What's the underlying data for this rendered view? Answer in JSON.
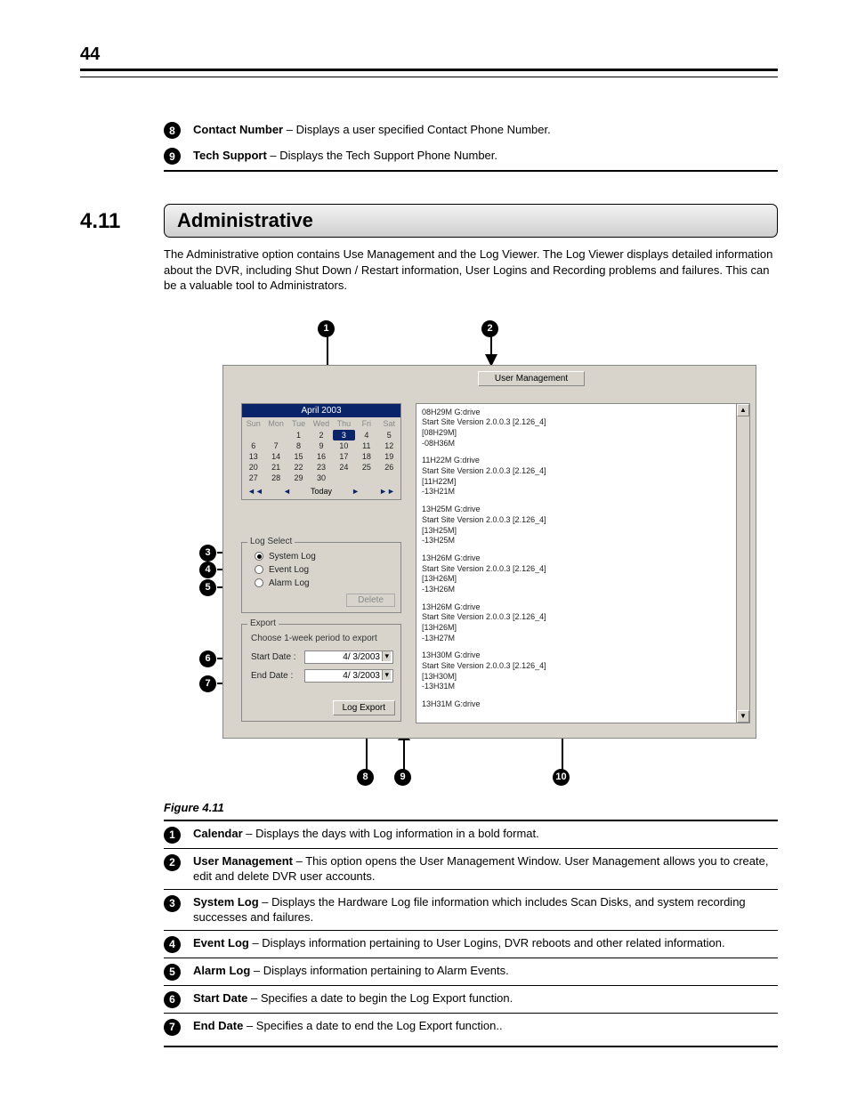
{
  "page_number": "44",
  "top_items": [
    {
      "n": "8",
      "term": "Contact Number",
      "desc": " – Displays a user specified Contact Phone Number."
    },
    {
      "n": "9",
      "term": "Tech Support",
      "desc": " – Displays the Tech Support Phone Number."
    }
  ],
  "section": {
    "number": "4.11",
    "title": "Administrative",
    "body": "The Administrative option contains Use Management and the Log Viewer. The Log Viewer displays detailed information about the DVR, including Shut Down / Restart information, User Logins and Recording problems and failures. This can be a valuable tool to Administrators."
  },
  "gui": {
    "user_mgmt_btn": "User Management",
    "calendar": {
      "title": "April 2003",
      "dow": [
        "Sun",
        "Mon",
        "Tue",
        "Wed",
        "Thu",
        "Fri",
        "Sat"
      ],
      "rows": [
        [
          "",
          "",
          "1",
          "2",
          "3",
          "4",
          "5"
        ],
        [
          "6",
          "7",
          "8",
          "9",
          "10",
          "11",
          "12"
        ],
        [
          "13",
          "14",
          "15",
          "16",
          "17",
          "18",
          "19"
        ],
        [
          "20",
          "21",
          "22",
          "23",
          "24",
          "25",
          "26"
        ],
        [
          "27",
          "28",
          "29",
          "30",
          "",
          "",
          ""
        ]
      ],
      "selected_day": "3",
      "nav_prev2": "◄◄",
      "nav_prev": "◄",
      "nav_today": "Today",
      "nav_next": "►",
      "nav_next2": "►►"
    },
    "log_select": {
      "legend": "Log Select",
      "system_log": "System Log",
      "event_log": "Event Log",
      "alarm_log": "Alarm Log",
      "selected": "system_log",
      "delete_btn": "Delete"
    },
    "export": {
      "legend": "Export",
      "hint": "Choose 1-week period to export",
      "start_label": "Start Date :",
      "start_value": "4/ 3/2003",
      "end_label": "End Date :",
      "end_value": "4/ 3/2003",
      "export_btn": "Log Export"
    },
    "log_entries": [
      [
        "08H29M G:drive",
        "Start Site Version 2.0.0.3 [2.126_4]",
        "[08H29M]",
        "-08H36M"
      ],
      [
        "11H22M G:drive",
        "Start Site Version 2.0.0.3 [2.126_4]",
        "[11H22M]",
        "-13H21M"
      ],
      [
        "13H25M G:drive",
        "Start Site Version 2.0.0.3 [2.126_4]",
        "[13H25M]",
        "-13H25M"
      ],
      [
        "13H26M G:drive",
        "Start Site Version 2.0.0.3 [2.126_4]",
        "[13H26M]",
        "-13H26M"
      ],
      [
        "13H26M G:drive",
        "Start Site Version 2.0.0.3 [2.126_4]",
        "[13H26M]",
        "-13H27M"
      ],
      [
        "13H30M G:drive",
        "Start Site Version 2.0.0.3 [2.126_4]",
        "[13H30M]",
        "-13H31M"
      ],
      [
        "13H31M G:drive"
      ]
    ]
  },
  "figure_caption": "Figure 4.11",
  "legend_items": [
    {
      "n": "1",
      "term": "Calendar",
      "desc": " – Displays the days with Log information in a bold format."
    },
    {
      "n": "2",
      "term": "User Management",
      "desc": " – This option opens the User Management Window. User Management allows you to create, edit and delete DVR user accounts."
    },
    {
      "n": "3",
      "term": "System Log",
      "desc": " – Displays the Hardware Log file information which includes Scan Disks, and system recording successes and failures."
    },
    {
      "n": "4",
      "term": "Event Log",
      "desc": " – Displays information pertaining to User Logins, DVR reboots and other related information."
    },
    {
      "n": "5",
      "term": "Alarm Log",
      "desc": " – Displays information pertaining to Alarm Events."
    },
    {
      "n": "6",
      "term": "Start Date",
      "desc": " – Specifies a date to begin the Log Export function."
    },
    {
      "n": "7",
      "term": "End Date",
      "desc": " – Specifies a date to end the Log Export function.."
    }
  ],
  "callout_numbers": {
    "c1": "1",
    "c2": "2",
    "c3": "3",
    "c4": "4",
    "c5": "5",
    "c6": "6",
    "c7": "7",
    "c8": "8",
    "c9": "9",
    "c10": "10"
  }
}
